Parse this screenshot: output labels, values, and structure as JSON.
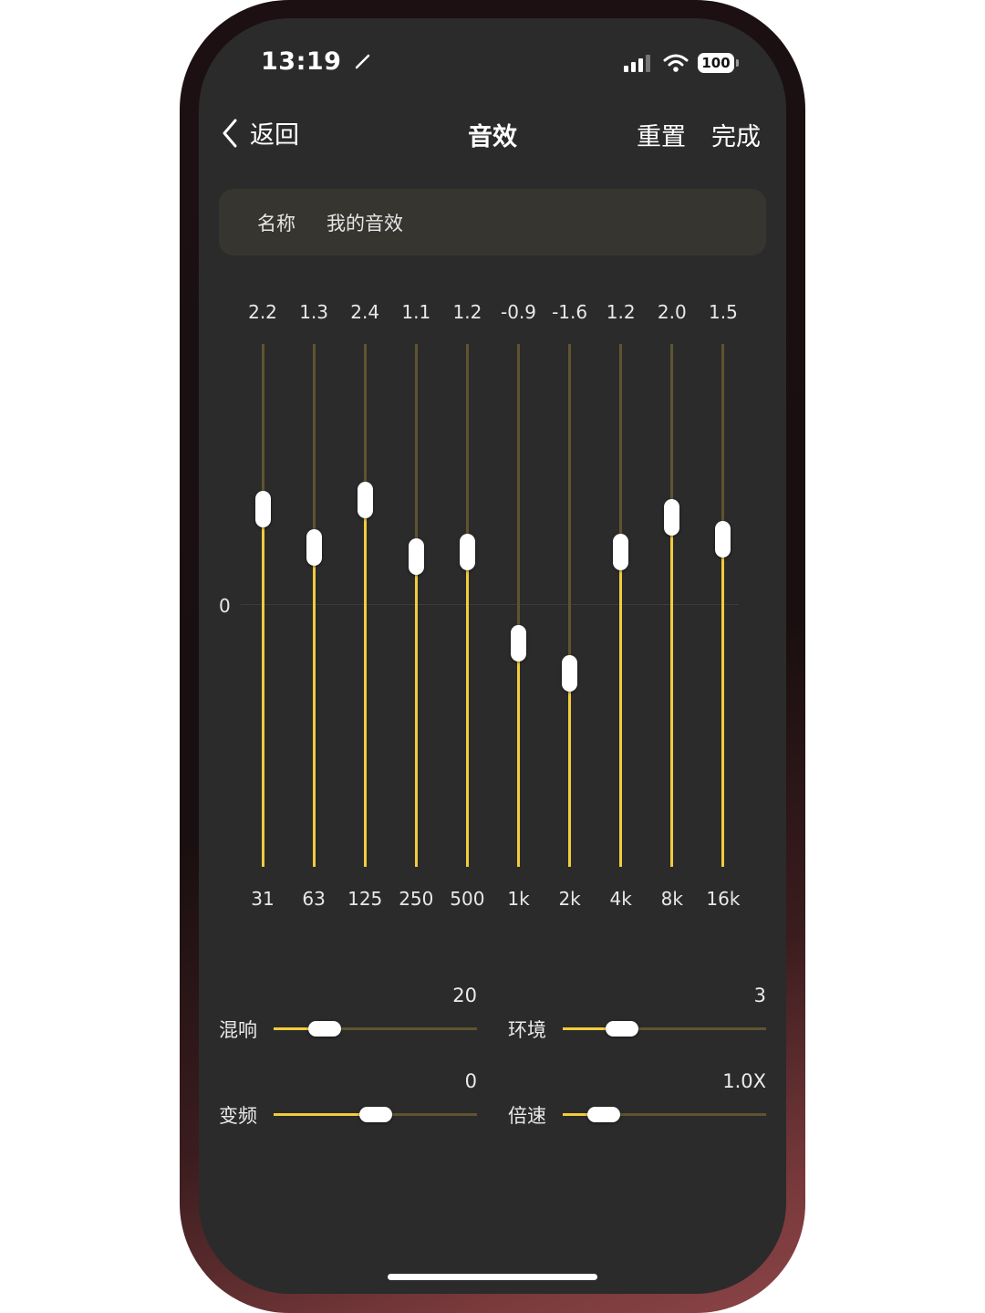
{
  "status_bar": {
    "time": "13:19",
    "battery": "100",
    "location_icon": "location-arrow-icon",
    "signal_icon": "cellular-signal-icon",
    "wifi_icon": "wifi-icon"
  },
  "nav": {
    "back_label": "返回",
    "title": "音效",
    "reset_label": "重置",
    "done_label": "完成"
  },
  "name_field": {
    "label": "名称",
    "value": "我的音效"
  },
  "equalizer": {
    "zero_label": "0",
    "range_db": [
      -6,
      6
    ],
    "bands": [
      {
        "freq": "31",
        "value": "2.2",
        "gain": 2.2
      },
      {
        "freq": "63",
        "value": "1.3",
        "gain": 1.3
      },
      {
        "freq": "125",
        "value": "2.4",
        "gain": 2.4
      },
      {
        "freq": "250",
        "value": "1.1",
        "gain": 1.1
      },
      {
        "freq": "500",
        "value": "1.2",
        "gain": 1.2
      },
      {
        "freq": "1k",
        "value": "-0.9",
        "gain": -0.9
      },
      {
        "freq": "2k",
        "value": "-1.6",
        "gain": -1.6
      },
      {
        "freq": "4k",
        "value": "1.2",
        "gain": 1.2
      },
      {
        "freq": "8k",
        "value": "2.0",
        "gain": 2.0
      },
      {
        "freq": "16k",
        "value": "1.5",
        "gain": 1.5
      }
    ],
    "colors": {
      "fill": "#f2cc3c",
      "track": "#5e5430"
    }
  },
  "controls": {
    "reverb": {
      "label": "混响",
      "value": "20",
      "level": 0.25
    },
    "ambience": {
      "label": "环境",
      "value": "3",
      "level": 0.29
    },
    "pitch": {
      "label": "变频",
      "value": "0",
      "level": 0.5
    },
    "speed": {
      "label": "倍速",
      "value": "1.0X",
      "level": 0.2
    }
  }
}
